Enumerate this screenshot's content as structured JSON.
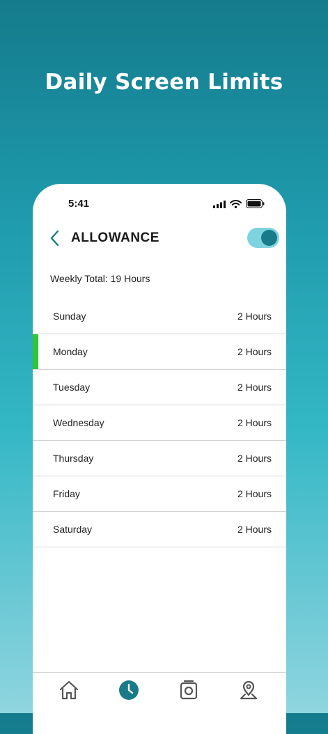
{
  "headline": "Daily Screen Limits",
  "status_bar": {
    "time": "5:41"
  },
  "header": {
    "title": "ALLOWANCE",
    "back_icon": "chevron-left-icon",
    "toggle_on": true
  },
  "weekly_total": "Weekly Total: 19 Hours",
  "days": [
    {
      "name": "Sunday",
      "hours": "2 Hours"
    },
    {
      "name": "Monday",
      "hours": "2 Hours",
      "selected": true
    },
    {
      "name": "Tuesday",
      "hours": "2 Hours"
    },
    {
      "name": "Wednesday",
      "hours": "2 Hours"
    },
    {
      "name": "Thursday",
      "hours": "2 Hours"
    },
    {
      "name": "Friday",
      "hours": "2 Hours"
    },
    {
      "name": "Saturday",
      "hours": "2 Hours"
    }
  ],
  "tab_bar": {
    "tabs": [
      {
        "icon": "home-icon"
      },
      {
        "icon": "clock-icon",
        "active": true
      },
      {
        "icon": "camera-icon"
      },
      {
        "icon": "location-pin-icon"
      }
    ]
  },
  "colors": {
    "accent": "#197b89",
    "toggle_track": "#7dd3de",
    "selected_marker": "#2fc536",
    "icon_gray": "#555555"
  }
}
